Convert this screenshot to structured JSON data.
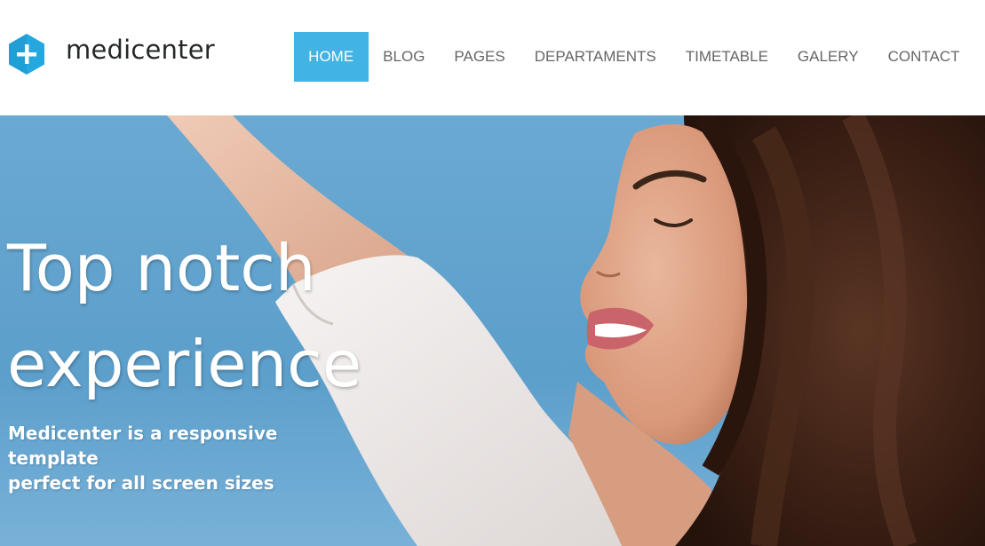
{
  "brand": {
    "name": "medicenter",
    "logo_icon": "hexagon-plus-icon",
    "accent_color": "#42b3e5"
  },
  "nav": {
    "items": [
      {
        "label": "HOME",
        "active": true
      },
      {
        "label": "BLOG",
        "active": false
      },
      {
        "label": "PAGES",
        "active": false
      },
      {
        "label": "DEPARTAMENTS",
        "active": false
      },
      {
        "label": "TIMETABLE",
        "active": false
      },
      {
        "label": "GALERY",
        "active": false
      },
      {
        "label": "CONTACT",
        "active": false
      }
    ]
  },
  "hero": {
    "title_line1": "Top notch",
    "title_line2": "experience",
    "subtitle_line1": "Medicenter is a responsive template",
    "subtitle_line2": "perfect for all screen sizes",
    "image": "woman-smiling-sky-photo"
  }
}
